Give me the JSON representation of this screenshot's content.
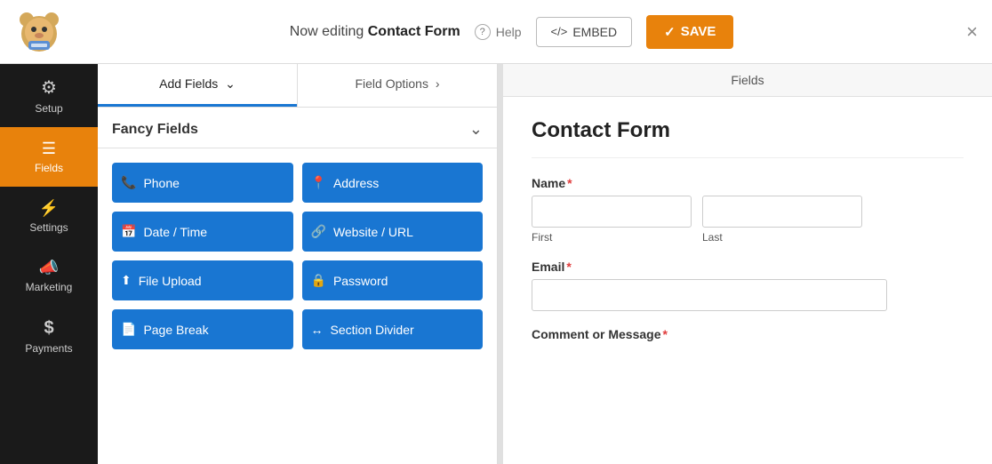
{
  "header": {
    "editing_prefix": "Now editing ",
    "form_name": "Contact Form",
    "help_label": "Help",
    "embed_label": "EMBED",
    "save_label": "SAVE",
    "close_label": "×"
  },
  "sidebar": {
    "items": [
      {
        "id": "setup",
        "label": "Setup",
        "icon": "⚙️",
        "active": false
      },
      {
        "id": "fields",
        "label": "Fields",
        "icon": "☰",
        "active": true
      },
      {
        "id": "settings",
        "label": "Settings",
        "icon": "⚡",
        "active": false
      },
      {
        "id": "marketing",
        "label": "Marketing",
        "icon": "📣",
        "active": false
      },
      {
        "id": "payments",
        "label": "Payments",
        "icon": "$",
        "active": false
      }
    ]
  },
  "fields_panel": {
    "tabs": [
      {
        "id": "add-fields",
        "label": "Add Fields",
        "active": true
      },
      {
        "id": "field-options",
        "label": "Field Options",
        "active": false
      }
    ],
    "fancy_fields_title": "Fancy Fields",
    "fields": [
      {
        "id": "phone",
        "label": "Phone",
        "icon": "📞"
      },
      {
        "id": "address",
        "label": "Address",
        "icon": "📍"
      },
      {
        "id": "date-time",
        "label": "Date / Time",
        "icon": "📅"
      },
      {
        "id": "website-url",
        "label": "Website / URL",
        "icon": "🔗"
      },
      {
        "id": "file-upload",
        "label": "File Upload",
        "icon": "⬆"
      },
      {
        "id": "password",
        "label": "Password",
        "icon": "🔒"
      },
      {
        "id": "page-break",
        "label": "Page Break",
        "icon": "📄"
      },
      {
        "id": "section-divider",
        "label": "Section Divider",
        "icon": "↔"
      }
    ]
  },
  "form_preview": {
    "header_label": "Fields",
    "form_title": "Contact Form",
    "fields": [
      {
        "id": "name",
        "label": "Name",
        "required": true,
        "type": "name",
        "subfields": [
          {
            "placeholder": "",
            "sublabel": "First"
          },
          {
            "placeholder": "",
            "sublabel": "Last"
          }
        ]
      },
      {
        "id": "email",
        "label": "Email",
        "required": true,
        "type": "text"
      },
      {
        "id": "comment",
        "label": "Comment or Message",
        "required": true,
        "type": "text"
      }
    ]
  },
  "icons": {
    "setup": "⚙",
    "fields": "≡",
    "settings": "⊞",
    "marketing": "◎",
    "payments": "$",
    "help": "?",
    "embed": "</>",
    "save_check": "✓",
    "chevron_down": "⌄",
    "chevron_right": "›"
  }
}
